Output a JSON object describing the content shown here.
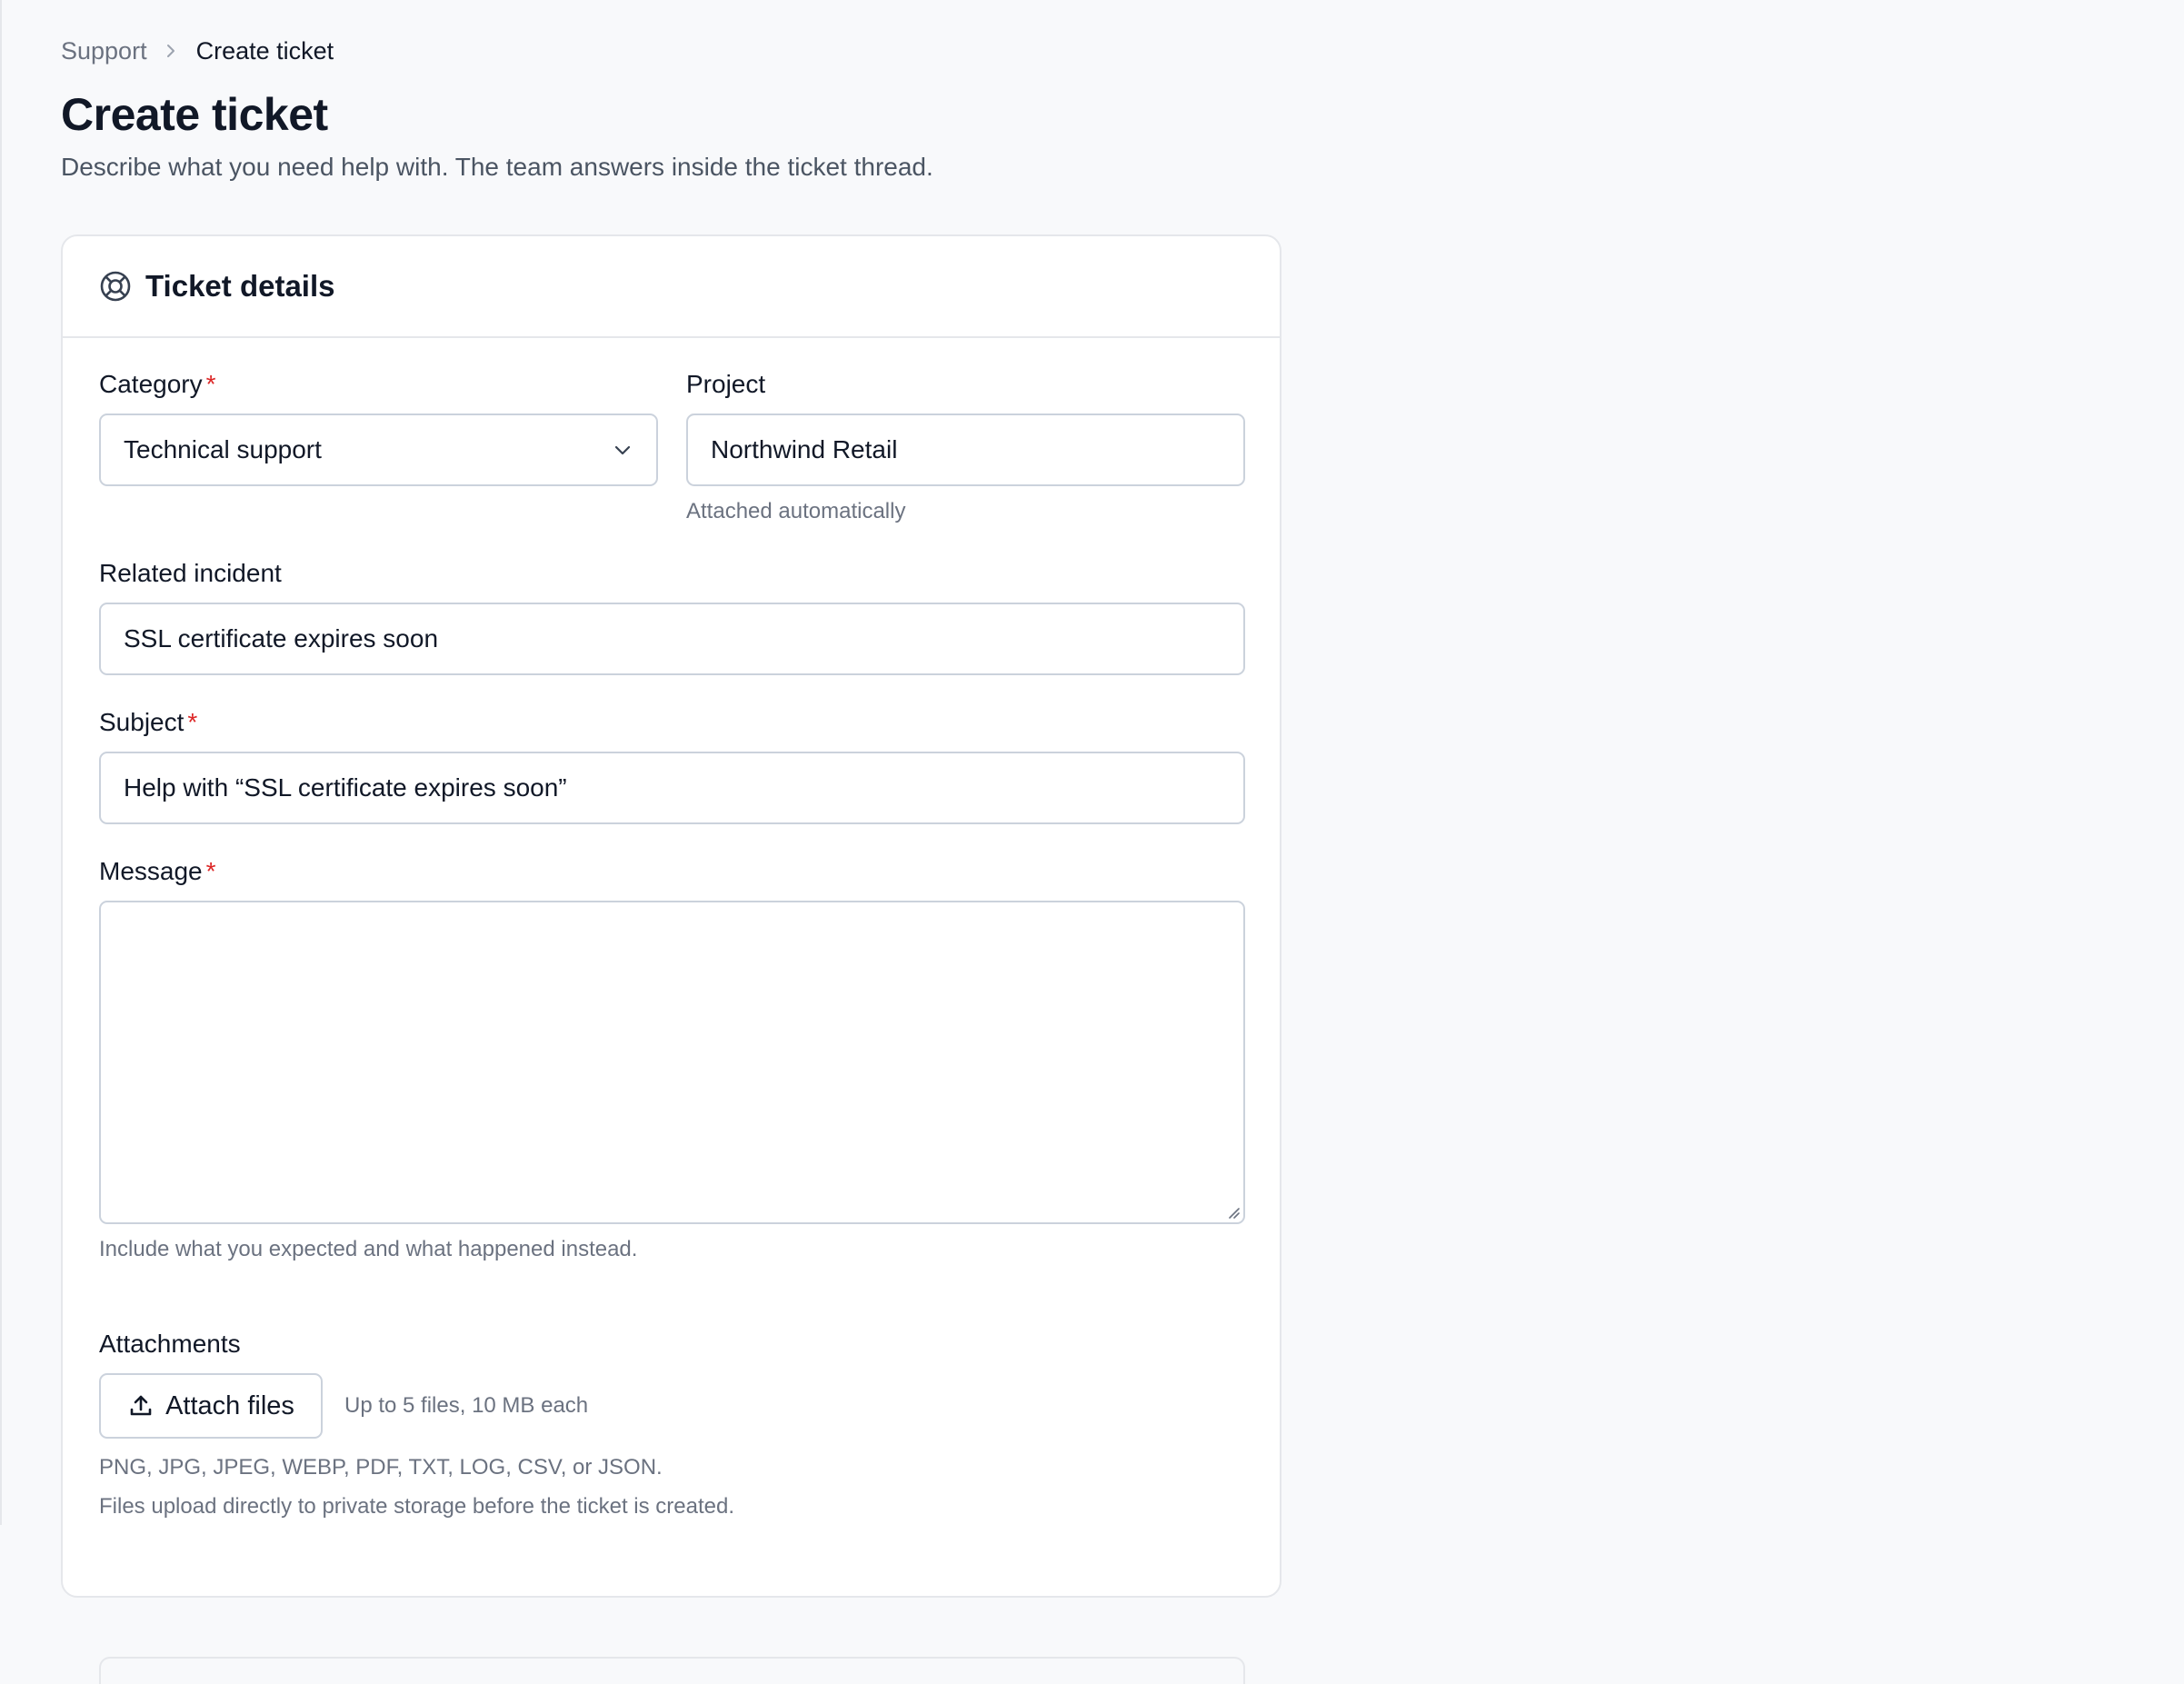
{
  "breadcrumb": {
    "parent": "Support",
    "current": "Create ticket"
  },
  "page": {
    "title": "Create ticket",
    "subtitle": "Describe what you need help with. The team answers inside the ticket thread."
  },
  "card": {
    "title": "Ticket details",
    "icon": "lifebuoy-icon"
  },
  "form": {
    "category": {
      "label": "Category",
      "required_mark": "*",
      "value": "Technical support"
    },
    "project": {
      "label": "Project",
      "value": "Northwind Retail",
      "hint": "Attached automatically"
    },
    "related_incident": {
      "label": "Related incident",
      "value": "SSL certificate expires soon"
    },
    "subject": {
      "label": "Subject",
      "required_mark": "*",
      "value": "Help with “SSL certificate expires soon”"
    },
    "message": {
      "label": "Message",
      "required_mark": "*",
      "value": "",
      "hint": "Include what you expected and what happened instead."
    },
    "attachments": {
      "label": "Attachments",
      "button_label": "Attach files",
      "limit_text": "Up to 5 files, 10 MB each",
      "types_text": "PNG, JPG, JPEG, WEBP, PDF, TXT, LOG, CSV, or JSON.",
      "storage_text": "Files upload directly to private storage before the ticket is created."
    }
  },
  "colors": {
    "background": "#f8f9fb",
    "card": "#ffffff",
    "border": "#e5e7eb",
    "input_border": "#cbd2dc",
    "required": "#dc2626",
    "muted_text": "#6b7280"
  }
}
